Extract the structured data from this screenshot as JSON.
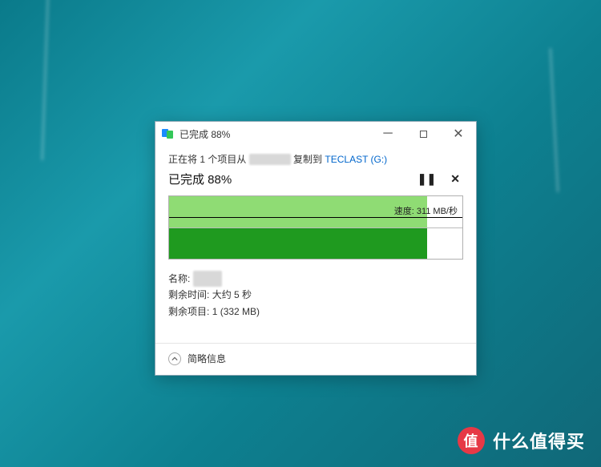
{
  "window": {
    "title": "已完成 88%",
    "percent": 88
  },
  "op": {
    "source_prefix": "正在将 1 个项目从",
    "source_mid": "复制到",
    "destination": "TECLAST (G:)",
    "headline": "已完成 88%",
    "pause_glyph": "❚❚",
    "cancel_glyph": "✕"
  },
  "graph": {
    "speed_label_prefix": "速度: ",
    "speed_value": "311 MB/秒",
    "progress_percent": 88,
    "speed_line_fraction": 0.33
  },
  "details": {
    "name_label": "名称:",
    "time_label": "剩余时间:",
    "time_value": "大约 5 秒",
    "items_label": "剩余项目:",
    "items_value": "1 (332 MB)"
  },
  "footer": {
    "toggle_label": "简略信息"
  },
  "watermark": {
    "badge": "值",
    "text": "什么值得买"
  }
}
